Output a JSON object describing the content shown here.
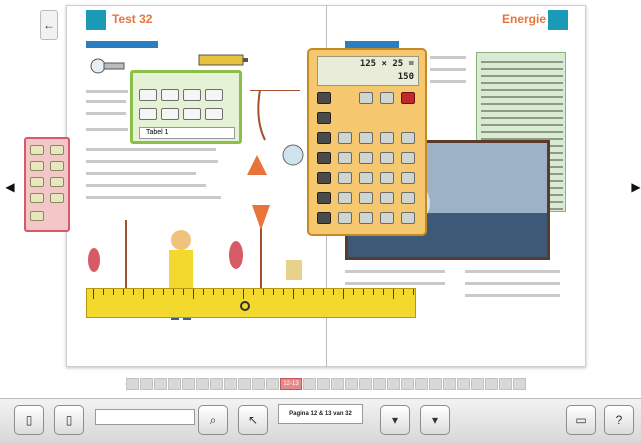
{
  "book": {
    "left_page": {
      "chapter_title": "Test 32"
    },
    "right_page": {
      "chapter_title": "Energie"
    }
  },
  "calculator": {
    "expression": "125 × 25 =",
    "result": "150"
  },
  "green_panel": {
    "select_value": "Tabel 1"
  },
  "navigation": {
    "prev_icon": "triangle-left",
    "next_icon": "triangle-right",
    "collapse_icon": "arrow-left"
  },
  "page_strip": {
    "active_label": "12-13"
  },
  "toolbar": {
    "page_label": "Pagina 12 & 13 van 32"
  },
  "colors": {
    "accent_blue": "#1b9ab8",
    "title_orange": "#e8743b",
    "calculator_body": "#f5c870",
    "ruler_yellow": "#f3d92e",
    "panel_green": "#8cbf4a",
    "palette_red": "#d65b66"
  }
}
